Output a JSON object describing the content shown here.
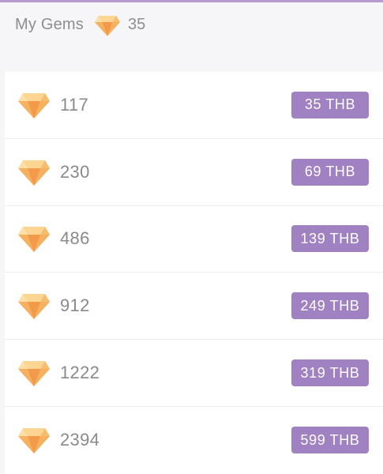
{
  "header": {
    "label": "My Gems",
    "gem_icon": "gem-icon",
    "count": "35"
  },
  "colors": {
    "accent": "#a081c1",
    "top_border": "#b69ad0",
    "gem_light": "#fbc97a",
    "gem_dark": "#f29a4a"
  },
  "packages": [
    {
      "gems": "117",
      "price": "35 THB"
    },
    {
      "gems": "230",
      "price": "69 THB"
    },
    {
      "gems": "486",
      "price": "139 THB"
    },
    {
      "gems": "912",
      "price": "249 THB"
    },
    {
      "gems": "1222",
      "price": "319 THB"
    },
    {
      "gems": "2394",
      "price": "599 THB"
    }
  ]
}
